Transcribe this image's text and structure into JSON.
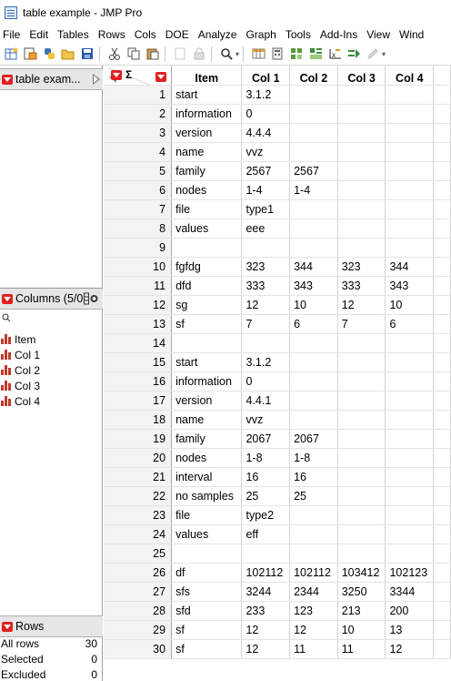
{
  "window": {
    "title": "table example - JMP Pro"
  },
  "menu": [
    "File",
    "Edit",
    "Tables",
    "Rows",
    "Cols",
    "DOE",
    "Analyze",
    "Graph",
    "Tools",
    "Add-Ins",
    "View",
    "Wind"
  ],
  "toolbar": {
    "icons": [
      "new-table-icon",
      "open-data-icon",
      "python-icon",
      "open-folder-icon",
      "save-icon",
      "cut-icon",
      "copy-icon",
      "paste-icon",
      "copy-disabled-icon",
      "lock-disabled-icon",
      "search-icon",
      "table-icon",
      "calculator-icon",
      "distribution-icon",
      "fit-y-by-x-icon",
      "graph-builder-icon",
      "edit-icon"
    ]
  },
  "left_panel": {
    "table_panel_title": "table exam...",
    "columns_panel_title": "Columns (5/0",
    "columns": [
      "Item",
      "Col 1",
      "Col 2",
      "Col 3",
      "Col 4"
    ],
    "rows_panel_title": "Rows",
    "rows_stats": [
      {
        "label": "All rows",
        "value": "30"
      },
      {
        "label": "Selected",
        "value": "0"
      },
      {
        "label": "Excluded",
        "value": "0"
      }
    ]
  },
  "grid": {
    "corner_symbol": "Σ",
    "headers": [
      "Item",
      "Col 1",
      "Col 2",
      "Col 3",
      "Col 4"
    ],
    "rows": [
      [
        "1",
        "start",
        "3.1.2",
        "",
        "",
        ""
      ],
      [
        "2",
        "information",
        "0",
        "",
        "",
        ""
      ],
      [
        "3",
        "version",
        "4.4.4",
        "",
        "",
        ""
      ],
      [
        "4",
        "name",
        "vvz",
        "",
        "",
        ""
      ],
      [
        "5",
        "family",
        "2567",
        "2567",
        "",
        ""
      ],
      [
        "6",
        "nodes",
        "1-4",
        "1-4",
        "",
        ""
      ],
      [
        "7",
        "file",
        "type1",
        "",
        "",
        ""
      ],
      [
        "8",
        "values",
        "eee",
        "",
        "",
        ""
      ],
      [
        "9",
        "",
        "",
        "",
        "",
        ""
      ],
      [
        "10",
        "fgfdg",
        "323",
        "344",
        "323",
        "344"
      ],
      [
        "11",
        "dfd",
        "333",
        "343",
        "333",
        "343"
      ],
      [
        "12",
        "sg",
        "12",
        "10",
        "12",
        "10"
      ],
      [
        "13",
        "sf",
        "7",
        "6",
        "7",
        "6"
      ],
      [
        "14",
        "",
        "",
        "",
        "",
        ""
      ],
      [
        "15",
        "start",
        "3.1.2",
        "",
        "",
        ""
      ],
      [
        "16",
        "information",
        "0",
        "",
        "",
        ""
      ],
      [
        "17",
        "version",
        "4.4.1",
        "",
        "",
        ""
      ],
      [
        "18",
        "name",
        "vvz",
        "",
        "",
        ""
      ],
      [
        "19",
        "family",
        "2067",
        "2067",
        "",
        ""
      ],
      [
        "20",
        "nodes",
        "1-8",
        "1-8",
        "",
        ""
      ],
      [
        "21",
        "interval",
        "16",
        "16",
        "",
        ""
      ],
      [
        "22",
        "no samples",
        "25",
        "25",
        "",
        ""
      ],
      [
        "23",
        "file",
        "type2",
        "",
        "",
        ""
      ],
      [
        "24",
        "values",
        "eff",
        "",
        "",
        ""
      ],
      [
        "25",
        "",
        "",
        "",
        "",
        ""
      ],
      [
        "26",
        "df",
        "102112",
        "102112",
        "103412",
        "102123"
      ],
      [
        "27",
        "sfs",
        "3244",
        "2344",
        "3250",
        "3344"
      ],
      [
        "28",
        "sfd",
        "233",
        "123",
        "213",
        "200"
      ],
      [
        "29",
        "sf",
        "12",
        "12",
        "10",
        "13"
      ],
      [
        "30",
        "sf",
        "12",
        "11",
        "11",
        "12"
      ]
    ]
  }
}
